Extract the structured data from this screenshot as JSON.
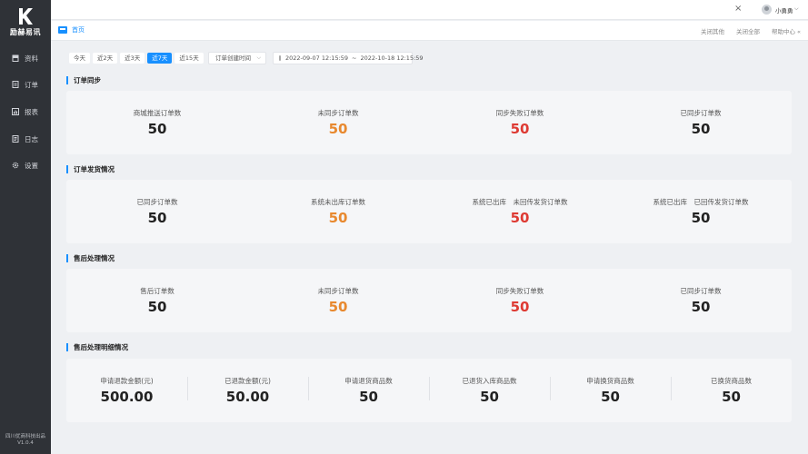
{
  "brand": {
    "name": "励赫易讯"
  },
  "sidebar": {
    "items": [
      {
        "label": "资料",
        "icon": "archive-icon"
      },
      {
        "label": "订单",
        "icon": "order-icon"
      },
      {
        "label": "报表",
        "icon": "chart-icon"
      },
      {
        "label": "日志",
        "icon": "log-icon"
      },
      {
        "label": "设置",
        "icon": "gear-icon"
      }
    ],
    "footer_line1": "四川优商科技出品",
    "footer_line2": "V1.0.4"
  },
  "topbar": {
    "close_icon": "×",
    "username": "小勇勇",
    "caret": "⌵"
  },
  "tabs": {
    "home_label": "首页",
    "actions": [
      "关闭其他",
      "关闭全部",
      "帮助中心 «"
    ]
  },
  "filters": {
    "ranges": [
      "今天",
      "近2天",
      "近3天",
      "近7天",
      "近15天"
    ],
    "active_range_index": 3,
    "time_type": "订单创建时间",
    "date_start": "2022-09-07 12:15:59",
    "date_sep": "~",
    "date_end": "2022-10-18 12:15:59"
  },
  "colors": {
    "accent": "#1890ff",
    "orange": "#e8892f",
    "red": "#de3b34",
    "sidebar": "#2f3237"
  },
  "sections": [
    {
      "title": "订单同步",
      "stats": [
        {
          "label": "商城推送订单数",
          "value": "50",
          "tone": "normal"
        },
        {
          "label": "未同步订单数",
          "value": "50",
          "tone": "orange"
        },
        {
          "label": "同步失败订单数",
          "value": "50",
          "tone": "red"
        },
        {
          "label": "已同步订单数",
          "value": "50",
          "tone": "normal"
        }
      ]
    },
    {
      "title": "订单发货情况",
      "stats": [
        {
          "label": "已同步订单数",
          "value": "50",
          "tone": "normal"
        },
        {
          "label": "系统未出库订单数",
          "value": "50",
          "tone": "orange"
        },
        {
          "label": "系统已出库　未回传发货订单数",
          "value": "50",
          "tone": "red"
        },
        {
          "label": "系统已出库　已回传发货订单数",
          "value": "50",
          "tone": "normal"
        }
      ]
    },
    {
      "title": "售后处理情况",
      "stats": [
        {
          "label": "售后订单数",
          "value": "50",
          "tone": "normal"
        },
        {
          "label": "未同步订单数",
          "value": "50",
          "tone": "orange"
        },
        {
          "label": "同步失败订单数",
          "value": "50",
          "tone": "red"
        },
        {
          "label": "已同步订单数",
          "value": "50",
          "tone": "normal"
        }
      ]
    },
    {
      "title": "售后处理明细情况",
      "stats": [
        {
          "label": "申请退款金额(元)",
          "value": "500.00",
          "tone": "normal"
        },
        {
          "label": "已退款金额(元)",
          "value": "50.00",
          "tone": "normal"
        },
        {
          "label": "申请退货商品数",
          "value": "50",
          "tone": "normal"
        },
        {
          "label": "已退货入库商品数",
          "value": "50",
          "tone": "normal"
        },
        {
          "label": "申请换货商品数",
          "value": "50",
          "tone": "normal"
        },
        {
          "label": "已换货商品数",
          "value": "50",
          "tone": "normal"
        }
      ]
    }
  ]
}
